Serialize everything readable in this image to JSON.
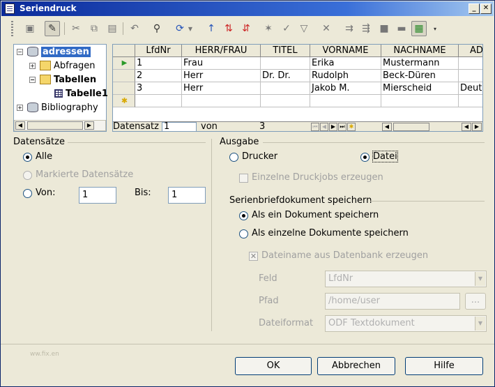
{
  "window": {
    "title": "Seriendruck"
  },
  "titlebar_buttons": {
    "minimize": "_",
    "maximize": "□",
    "close": "✕"
  },
  "toolbar": {
    "icons": [
      "save-icon",
      "edit-icon",
      "cut-icon",
      "copy-icon",
      "paste-icon",
      "undo-icon",
      "find-icon",
      "refresh-icon",
      "sort-ascending-icon",
      "sort-az-icon",
      "sort-za-icon",
      "autofilter-icon",
      "standard-filter-icon",
      "filter-icon",
      "remove-filter-icon",
      "data-to-text-icon",
      "data-to-fields-icon",
      "mail-merge-icon",
      "current-document-icon",
      "explorer-toggle-icon",
      "more-icon"
    ]
  },
  "tree": {
    "items": [
      {
        "label": "adressen",
        "expander": "−",
        "selected": true
      },
      {
        "label": "Abfragen",
        "expander": "+"
      },
      {
        "label": "Tabellen",
        "expander": "−"
      },
      {
        "label": "Tabelle1"
      },
      {
        "label": "Bibliography",
        "expander": "+"
      }
    ]
  },
  "grid": {
    "columns": [
      "LfdNr",
      "HERR/FRAU",
      "TITEL",
      "VORNAME",
      "NACHNAME",
      "AD"
    ],
    "rows": [
      [
        "1",
        "Frau",
        "",
        "Erika",
        "Mustermann",
        ""
      ],
      [
        "2",
        "Herr",
        "Dr. Dr.",
        "Rudolph",
        "Beck-Düren",
        ""
      ],
      [
        "3",
        "Herr",
        "",
        "Jakob M.",
        "Mierscheid",
        "Deuts"
      ]
    ],
    "nav": {
      "label": "Datensatz",
      "current": "1",
      "of": "von",
      "total": "3"
    }
  },
  "records": {
    "group_label": "Datensätze",
    "all": "Alle",
    "marked": "Markierte Datensätze",
    "from": "Von:",
    "from_value": "1",
    "to": "Bis:",
    "to_value": "1"
  },
  "output": {
    "group_label": "Ausgabe",
    "printer": "Drucker",
    "file": "Datei",
    "single_jobs": "Einzelne Druckjobs erzeugen",
    "save_group": "Serienbriefdokument speichern",
    "save_one": "Als ein Dokument speichern",
    "save_single": "Als einzelne Dokumente speichern",
    "filename_from_db": "Dateiname aus Datenbank erzeugen",
    "field_label": "Feld",
    "field_value": "LfdNr",
    "path_label": "Pfad",
    "path_value": "/home/user",
    "path_button": "...",
    "format_label": "Dateiformat",
    "format_value": "ODF Textdokument"
  },
  "buttons": {
    "ok": "OK",
    "cancel": "Abbrechen",
    "help": "Hilfe"
  },
  "footer": {
    "watermark": "ww.fix.en"
  }
}
